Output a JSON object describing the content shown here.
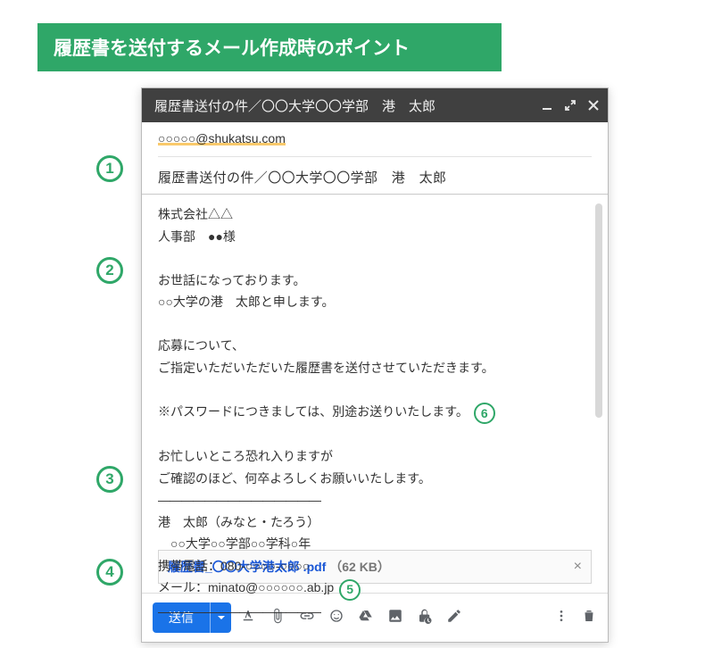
{
  "page_title": "履歴書を送付するメール作成時のポイント",
  "compose": {
    "window_title": "履歴書送付の件／〇〇大学〇〇学部　港　太郎",
    "to": "○○○○○@shukatsu.com",
    "subject": "履歴書送付の件／〇〇大学〇〇学部　港　太郎",
    "body": {
      "line1": "株式会社△△",
      "line2": "人事部　●●様",
      "line3": "お世話になっております。",
      "line4": "○○大学の港　太郎と申します。",
      "line5": "応募について、",
      "line6": "ご指定いただいただいた履歴書を送付させていただきます。",
      "line7_a": "※パスワードにつきましては、別途お送りいたします。",
      "line8": "お忙しいところ恐れ入りますが",
      "line9": "ご確認のほど、何卒よろしくお願いいたします。",
      "dash": "——————————————",
      "sig1": "港　太郎（みなと・たろう）",
      "sig2": "　○○大学○○学部○○学科○年",
      "sig3": "携帯電話：080-○○○○-○○○○",
      "sig4_a": "メール：minato@○○○○○○.ab.jp"
    },
    "attachment": {
      "name": "履歴書_〇〇大学港太郎 .pdf",
      "size": "（62 KB）"
    },
    "send_label": "送信"
  },
  "annotations": {
    "a1": "1",
    "a2": "2",
    "a3": "3",
    "a4": "4",
    "a5": "5",
    "a6": "6"
  }
}
